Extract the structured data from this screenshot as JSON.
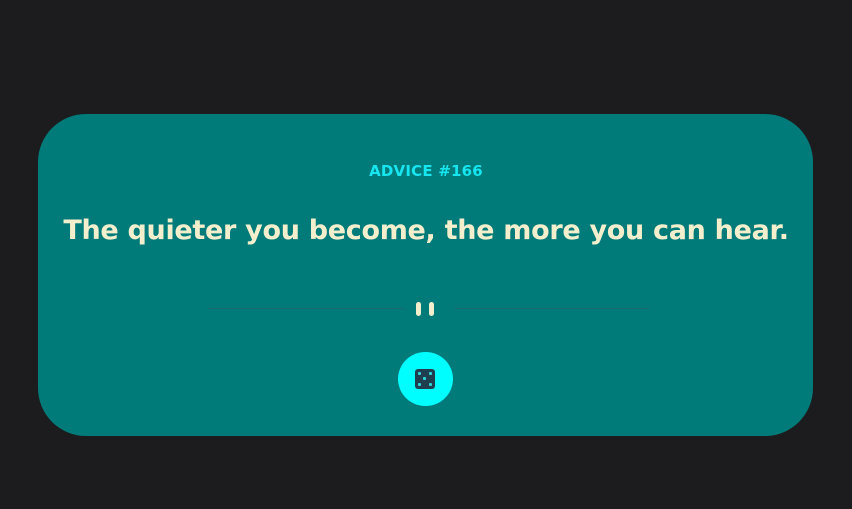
{
  "advice": {
    "id_label": "ADVICE #166",
    "quote": "The quieter you become, the more you can hear."
  },
  "divider": {
    "icon": "pause-icon"
  },
  "dice_button": {
    "icon": "dice-icon"
  },
  "colors": {
    "background": "#1c1b1d",
    "card": "#007b79",
    "accent": "#00feff",
    "quote_text": "#f3efcd",
    "id_text": "#16e6f0"
  }
}
